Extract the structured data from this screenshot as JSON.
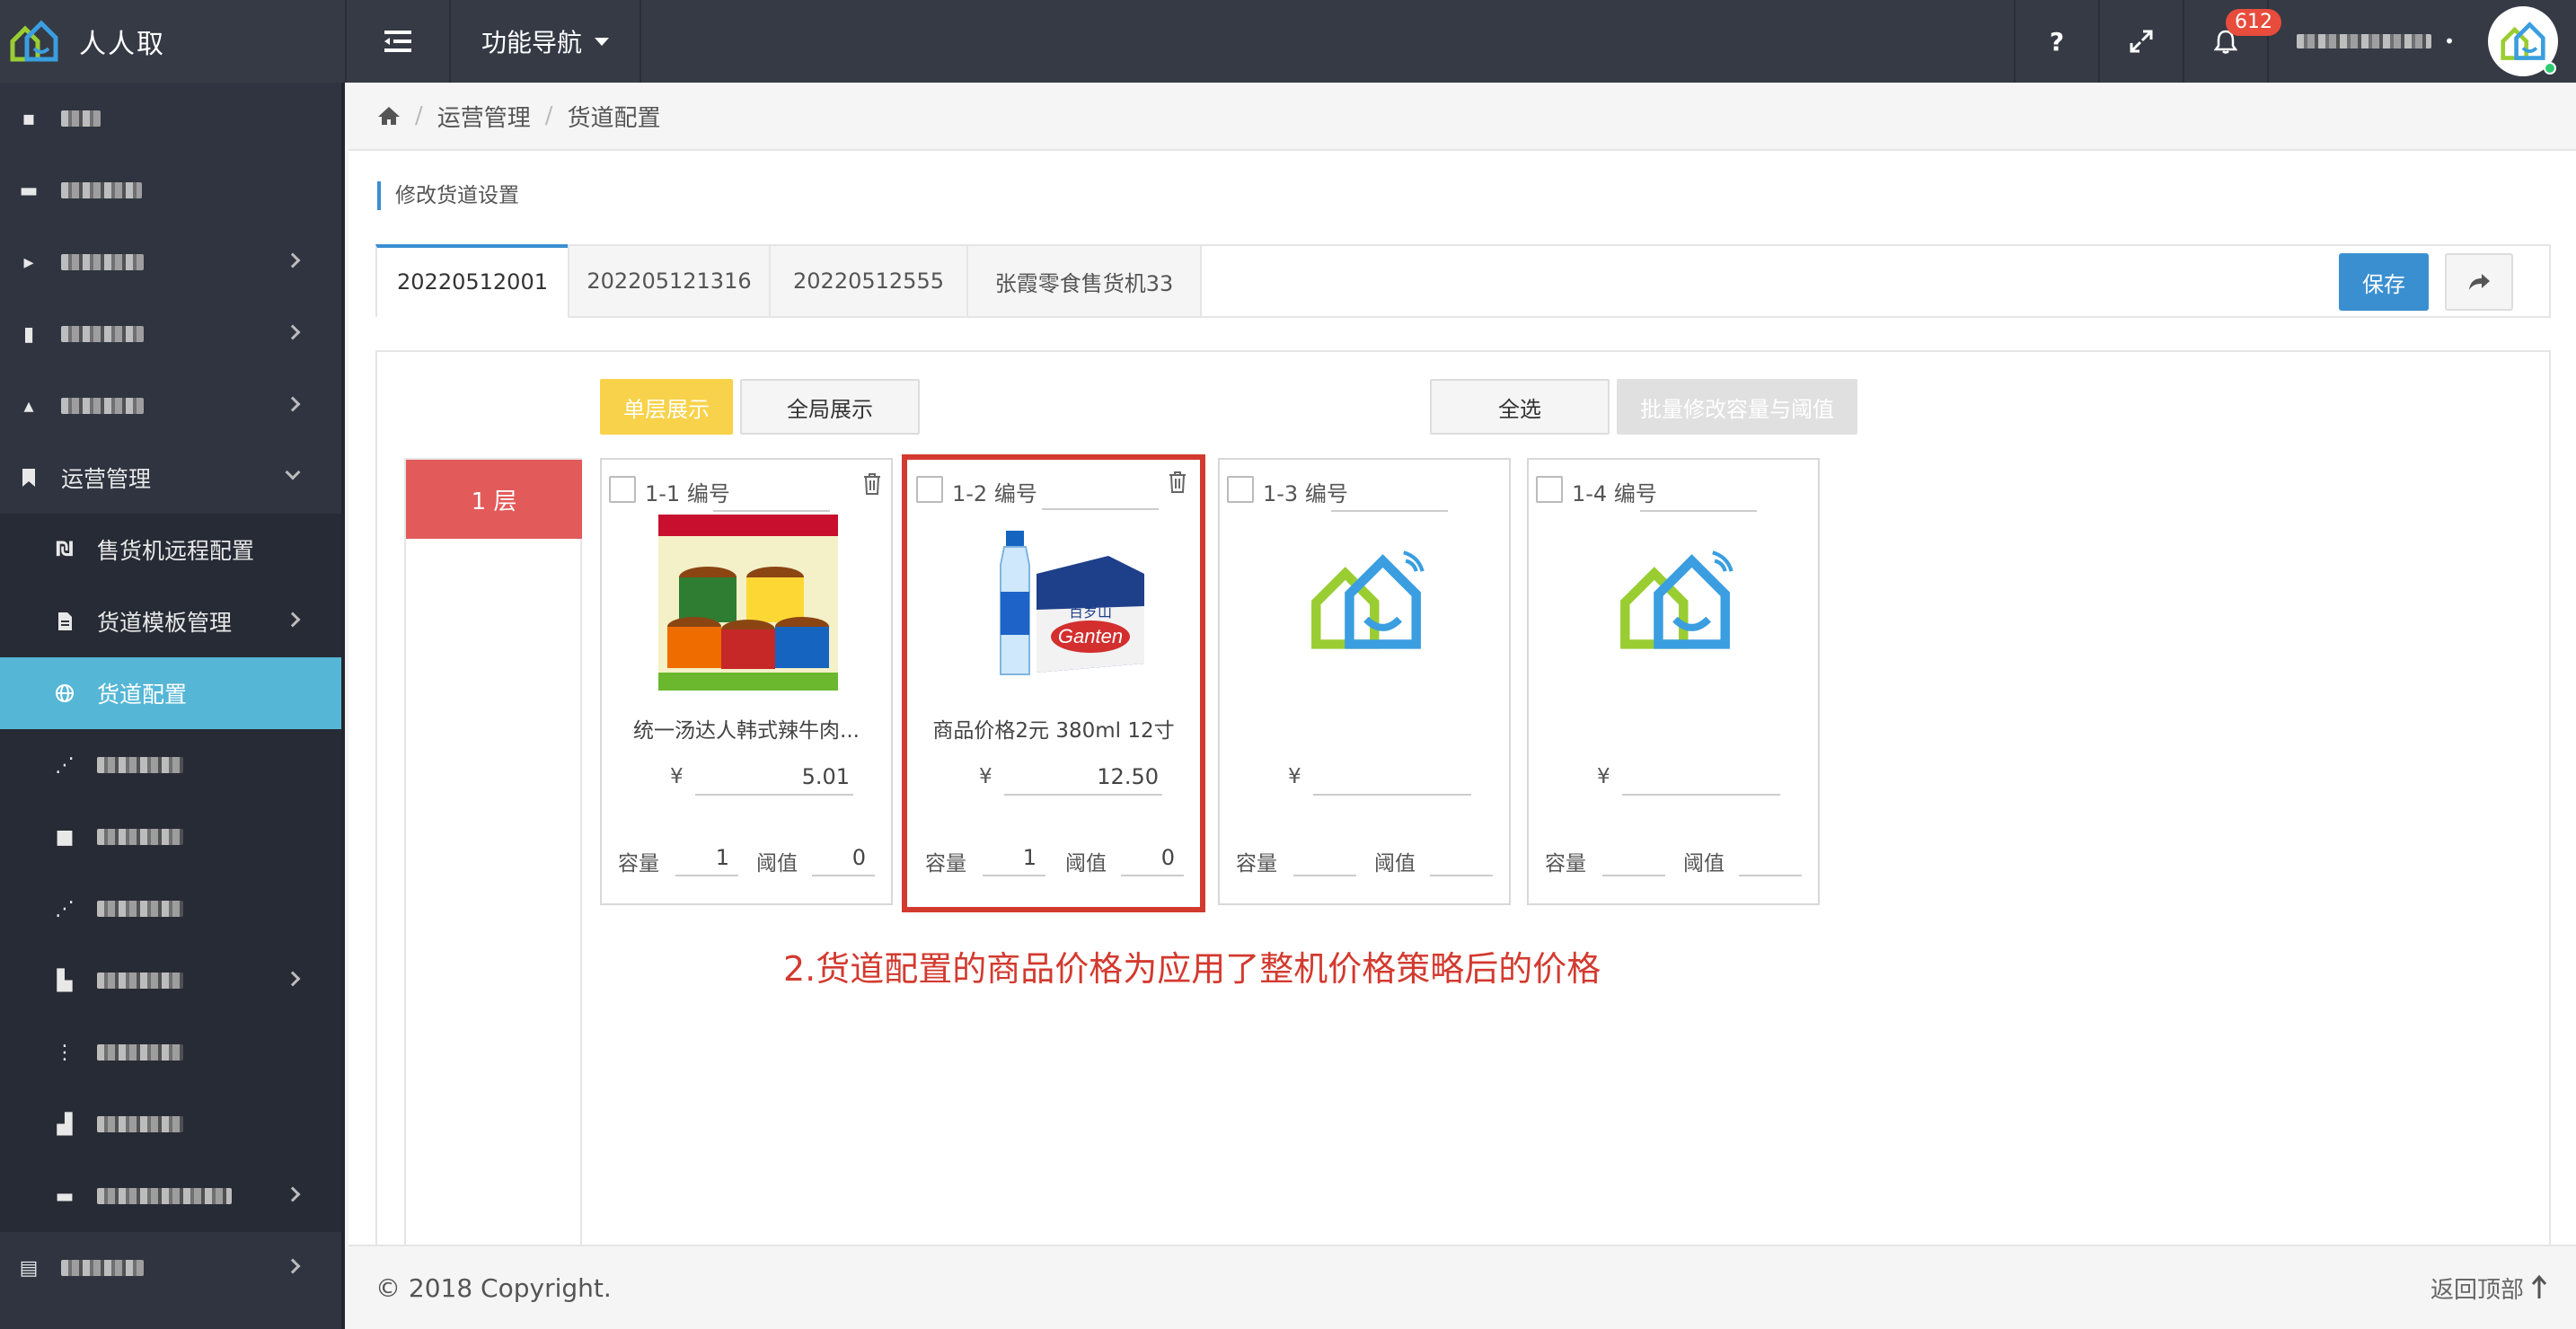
{
  "header": {
    "app_name": "人人取",
    "func_nav": "功能导航",
    "help_label": "?",
    "notifications": "612"
  },
  "sidebar": {
    "items": [
      {
        "label": "运营管理",
        "expanded": true
      },
      {
        "label": "售货机远程配置"
      },
      {
        "label": "货道模板管理"
      },
      {
        "label": "货道配置",
        "active": true
      }
    ]
  },
  "breadcrumb": [
    "运营管理",
    "货道配置"
  ],
  "section_title": "修改货道设置",
  "tabs": [
    "20220512001",
    "202205121316",
    "20220512555",
    "张霞零食售货机33"
  ],
  "toolbar": {
    "save": "保存",
    "single_layer": "单层展示",
    "global_view": "全局展示",
    "select_all": "全选",
    "batch_edit": "批量修改容量与阈值"
  },
  "layer_label": "1 层",
  "slot_labels": {
    "currency": "¥",
    "capacity": "容量",
    "threshold": "阈值"
  },
  "slots": [
    {
      "code": "1-1 编号",
      "name": "统一汤达人韩式辣牛肉...",
      "price": "5.01",
      "capacity": "1",
      "threshold": "0"
    },
    {
      "code": "1-2 编号",
      "name": "商品价格2元 380ml 12寸",
      "price": "12.50",
      "capacity": "1",
      "threshold": "0"
    },
    {
      "code": "1-3 编号",
      "name": "",
      "price": "",
      "capacity": "",
      "threshold": ""
    },
    {
      "code": "1-4 编号",
      "name": "",
      "price": "",
      "capacity": "",
      "threshold": ""
    }
  ],
  "annotation": "2.货道配置的商品价格为应用了整机价格策略后的价格",
  "footer": {
    "copyright": "© 2018 Copyright.",
    "back_to_top": "返回顶部"
  },
  "colors": {
    "header_bg": "#353a45",
    "sidebar_bg": "#2f3440",
    "active_item": "#55b6d6",
    "primary": "#3a8fd0",
    "layer_tab": "#e25a5a",
    "yellow": "#f8d24a",
    "highlight": "#d33a2f"
  }
}
